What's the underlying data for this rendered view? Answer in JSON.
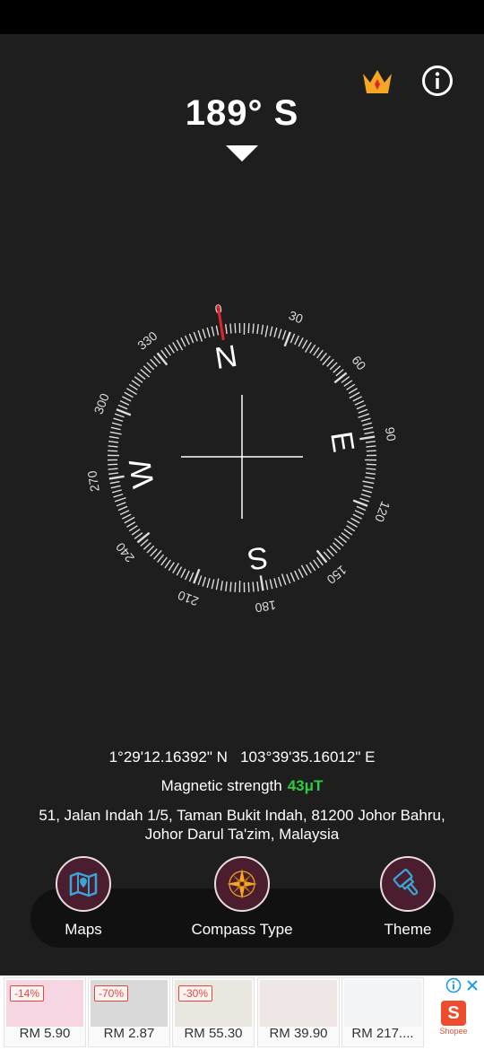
{
  "heading": {
    "value": "189° S"
  },
  "compass": {
    "degree_labels": [
      "180",
      "210",
      "240",
      "270",
      "300",
      "330",
      "0",
      "30",
      "60",
      "90",
      "120",
      "150"
    ],
    "cardinals": {
      "s": "S",
      "w": "W",
      "n": "N",
      "e": "E"
    },
    "heading_degrees": 189,
    "north_needle_color": "#e0242a"
  },
  "location": {
    "latitude": "1°29'12.16392\" N",
    "longitude": "103°39'35.16012\" E",
    "magnetic_label": "Magnetic strength",
    "magnetic_value": "43μT",
    "address_line1": "51, Jalan Indah 1/5, Taman Bukit Indah, 81200 Johor Bahru,",
    "address_line2": "Johor Darul Ta'zim, Malaysia"
  },
  "nav": {
    "maps_label": "Maps",
    "compass_type_label": "Compass Type",
    "theme_label": "Theme"
  },
  "ads": {
    "items": [
      {
        "discount": "-14%",
        "price": "RM 5.90"
      },
      {
        "discount": "-70%",
        "price": "RM 2.87"
      },
      {
        "discount": "-30%",
        "price": "RM 55.30"
      },
      {
        "discount": "",
        "price": "RM 39.90"
      },
      {
        "discount": "",
        "price": "RM 217...."
      }
    ],
    "brand_text": "Shopee",
    "brand_logo": "S"
  },
  "colors": {
    "background": "#1e1e1e",
    "accent_green": "#2ecc40",
    "crown": "#f5a623",
    "nav_circle": "#4a1e2e"
  }
}
